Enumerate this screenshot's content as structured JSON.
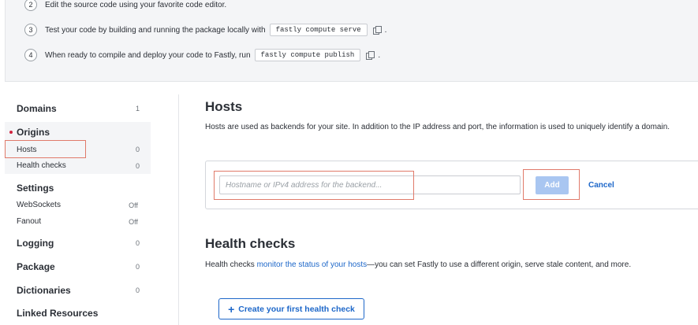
{
  "steps": [
    {
      "num": "2",
      "text": "Edit the source code using your favorite code editor."
    },
    {
      "num": "3",
      "text": "Test your code by building and running the package locally with",
      "code": "fastly compute serve",
      "end": "."
    },
    {
      "num": "4",
      "text": "When ready to compile and deploy your code to Fastly, run",
      "code": "fastly compute publish",
      "end": "."
    }
  ],
  "sidebar": {
    "domains": {
      "label": "Domains",
      "count": "1"
    },
    "origins": {
      "label": "Origins"
    },
    "hosts": {
      "label": "Hosts",
      "count": "0"
    },
    "health_checks": {
      "label": "Health checks",
      "count": "0"
    },
    "settings": {
      "label": "Settings"
    },
    "websockets": {
      "label": "WebSockets",
      "count": "Off"
    },
    "fanout": {
      "label": "Fanout",
      "count": "Off"
    },
    "logging": {
      "label": "Logging",
      "count": "0"
    },
    "package": {
      "label": "Package",
      "count": "0"
    },
    "dictionaries": {
      "label": "Dictionaries",
      "count": "0"
    },
    "linked_resources": {
      "label": "Linked Resources"
    }
  },
  "hosts_section": {
    "title": "Hosts",
    "description": "Hosts are used as backends for your site. In addition to the IP address and port, the information is used to uniquely identify a domain.",
    "input_placeholder": "Hostname or IPv4 address for the backend...",
    "add_label": "Add",
    "cancel_label": "Cancel"
  },
  "health_section": {
    "title": "Health checks",
    "desc_before": "Health checks ",
    "desc_link": "monitor the status of your hosts",
    "desc_after": "—you can set Fastly to use a different origin, serve stale content, and more.",
    "create_label": "Create your first health check"
  },
  "colors": {
    "accent": "#1d67c9",
    "origin_dot": "#d1243f",
    "highlight": "#e07a6a"
  }
}
